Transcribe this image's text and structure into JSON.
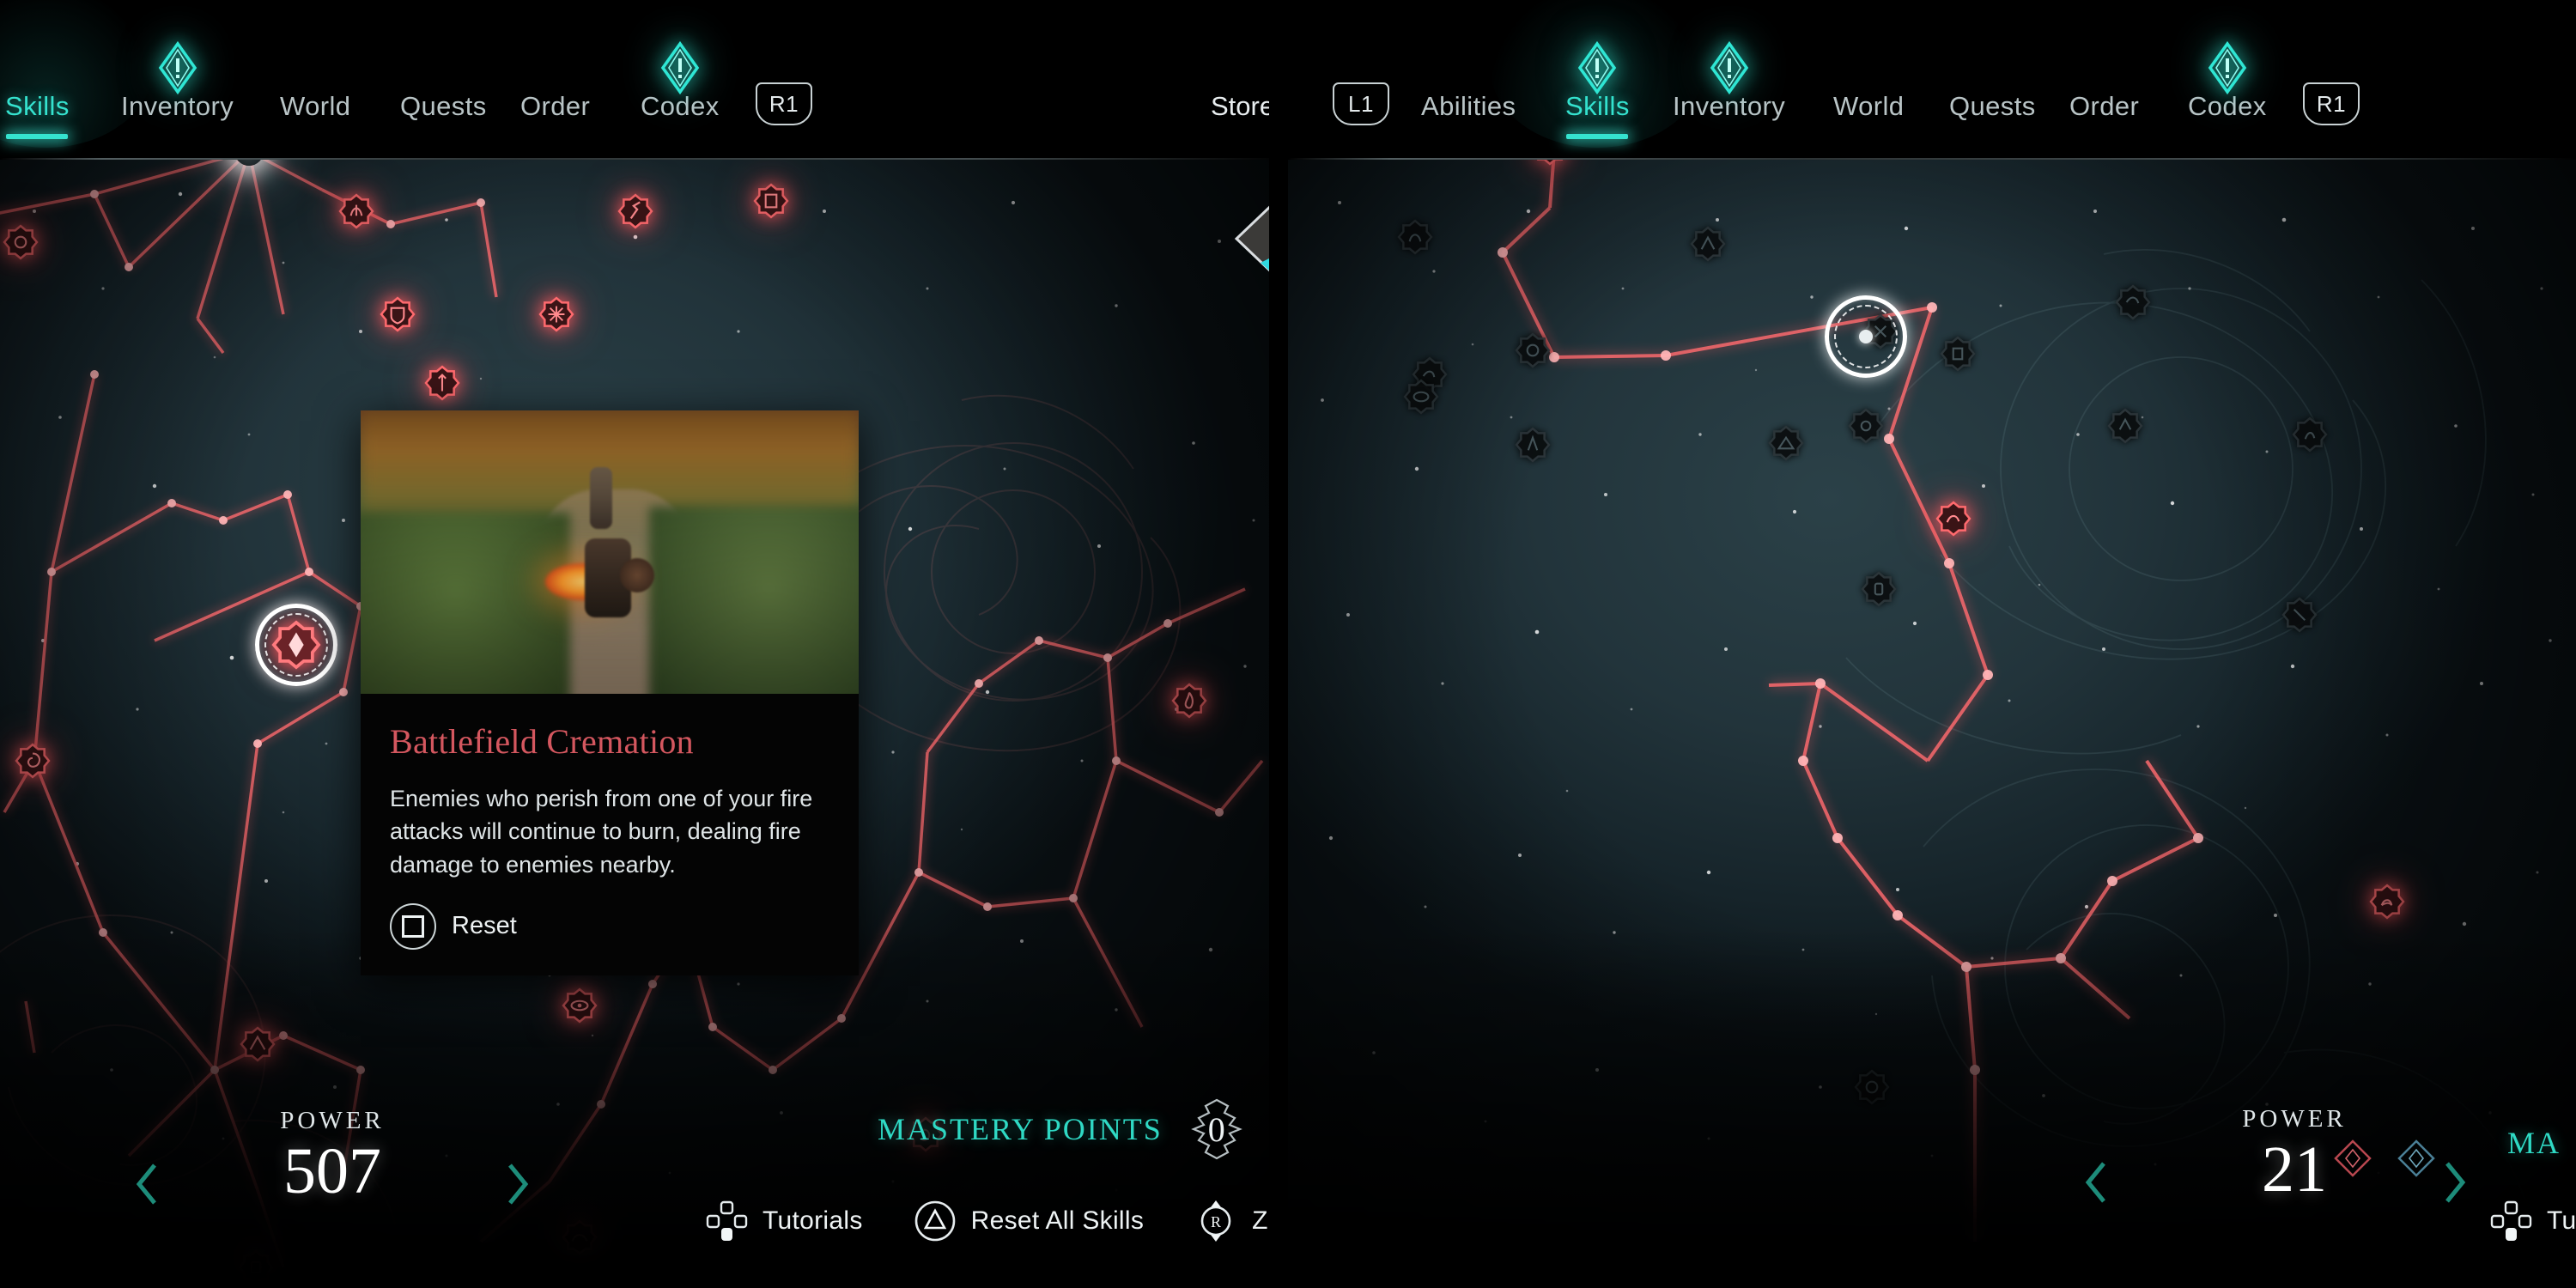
{
  "meta": {
    "accent_teal": "#35e3cf",
    "accent_red": "#ff5a5f",
    "title_red": "#d4575f",
    "text_light": "#e9eef0",
    "sky_dark": "#22343b"
  },
  "left_panel": {
    "nav": {
      "items": [
        {
          "label": "Skills",
          "active": true,
          "badge": false
        },
        {
          "label": "Inventory",
          "active": false,
          "badge": true
        },
        {
          "label": "World",
          "active": false,
          "badge": false
        },
        {
          "label": "Quests",
          "active": false,
          "badge": false
        },
        {
          "label": "Order",
          "active": false,
          "badge": false
        },
        {
          "label": "Codex",
          "active": false,
          "badge": true
        }
      ],
      "right_chip": "R1",
      "store_label": "Store"
    },
    "tooltip": {
      "title": "Battlefield Cremation",
      "description": "Enemies who perish from one of your fire attacks will continue to burn, dealing fire damage to enemies nearby.",
      "reset_label": "Reset",
      "reset_button_glyph": "square-button"
    },
    "hud": {
      "power_label": "POWER",
      "power_value": "507",
      "mastery_label": "MASTERY POINTS",
      "mastery_value": "0"
    },
    "actions": [
      {
        "label": "Tutorials",
        "glyph": "dpad-down"
      },
      {
        "label": "Reset All Skills",
        "glyph": "triangle-button"
      },
      {
        "label": "Zo",
        "glyph": "right-stick"
      }
    ]
  },
  "right_panel": {
    "nav": {
      "left_chip": "L1",
      "items": [
        {
          "label": "Abilities",
          "active": false,
          "badge": false
        },
        {
          "label": "Skills",
          "active": true,
          "badge": true
        },
        {
          "label": "Inventory",
          "active": false,
          "badge": true
        },
        {
          "label": "World",
          "active": false,
          "badge": false
        },
        {
          "label": "Quests",
          "active": false,
          "badge": false
        },
        {
          "label": "Order",
          "active": false,
          "badge": false
        },
        {
          "label": "Codex",
          "active": false,
          "badge": true
        }
      ],
      "right_chip": "R1"
    },
    "hud": {
      "power_label": "POWER",
      "power_value": "21",
      "mastery_label": "MA"
    },
    "actions": [
      {
        "label": "Tutorials",
        "glyph": "dpad-down"
      },
      {
        "label": "",
        "glyph": "triangle-button"
      }
    ]
  }
}
